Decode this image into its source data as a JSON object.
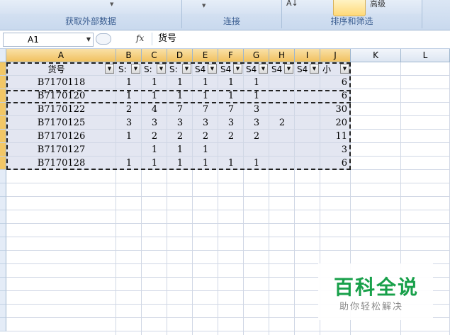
{
  "ribbon": {
    "groups": [
      {
        "label": "获取外部数据"
      },
      {
        "label": "连接"
      },
      {
        "label": "排序和筛选"
      }
    ],
    "sort_icon_label": "A↓",
    "advanced_label": "高级"
  },
  "formula_bar": {
    "name_box": "A1",
    "fx_label": "fx",
    "formula": "货号"
  },
  "columns": [
    "A",
    "B",
    "C",
    "D",
    "E",
    "F",
    "G",
    "H",
    "I",
    "J",
    "K",
    "L"
  ],
  "header_row": {
    "a": "货号",
    "cols": [
      "S:",
      "S:",
      "S:",
      "S4",
      "S4",
      "S4",
      "S4",
      "S4",
      "小"
    ]
  },
  "rows": [
    {
      "id": "B7170118",
      "vals": [
        "1",
        "1",
        "1",
        "1",
        "1",
        "1",
        "",
        "",
        ""
      ],
      "total": "6"
    },
    {
      "id": "B7170120",
      "vals": [
        "1",
        "1",
        "1",
        "1",
        "1",
        "1",
        "",
        "",
        ""
      ],
      "total": "6"
    },
    {
      "id": "B7170122",
      "vals": [
        "2",
        "4",
        "7",
        "7",
        "7",
        "3",
        "",
        "",
        ""
      ],
      "total": "30"
    },
    {
      "id": "B7170125",
      "vals": [
        "3",
        "3",
        "3",
        "3",
        "3",
        "3",
        "2",
        "",
        ""
      ],
      "total": "20"
    },
    {
      "id": "B7170126",
      "vals": [
        "1",
        "2",
        "2",
        "2",
        "2",
        "2",
        "",
        "",
        ""
      ],
      "total": "11"
    },
    {
      "id": "B7170127",
      "vals": [
        "",
        "1",
        "1",
        "1",
        "",
        "",
        "",
        "",
        ""
      ],
      "total": "3"
    },
    {
      "id": "B7170128",
      "vals": [
        "1",
        "1",
        "1",
        "1",
        "1",
        "1",
        "",
        "",
        ""
      ],
      "total": "6"
    }
  ],
  "watermark": {
    "title": "百科全说",
    "subtitle": "助你轻松解决"
  }
}
